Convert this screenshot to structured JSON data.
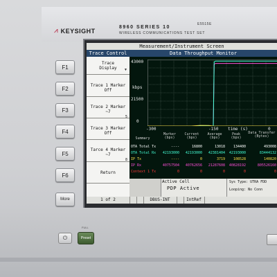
{
  "device": {
    "brand": "KEYSIGHT",
    "model": "8960 SERIES 10",
    "model_code": "E5515E",
    "subtitle": "WIRELESS COMMUNICATIONS TEST SET"
  },
  "function_keys": [
    "F1",
    "F2",
    "F3",
    "F4",
    "F5",
    "F6",
    "More"
  ],
  "screen": {
    "title": "Measurement/Instrument Screen",
    "soft_menu": {
      "header": "Trace Control",
      "items": [
        {
          "line1": "Trace",
          "line2": "Display",
          "marker": "▼"
        },
        {
          "line1": "Trace 1 Marker",
          "line2": "Off"
        },
        {
          "line1": "Trace 2 Marker",
          "line2": "~7",
          "marker": "5"
        },
        {
          "line1": "Trace 3 Marker",
          "line2": "Off"
        },
        {
          "line1": "Tarce 4 Marker",
          "line2": "~7",
          "marker": "8"
        },
        {
          "line1": "Return",
          "line2": ""
        }
      ],
      "page": "1 of 2"
    },
    "monitor": {
      "title": "Data Throughput Monitor",
      "y_unit": "kbps",
      "x_unit": "time (s)",
      "y_ticks": [
        "43000",
        "21500",
        "0"
      ],
      "x_ticks": [
        "-300",
        "-150",
        "0"
      ]
    },
    "table": {
      "headers": [
        "Summary",
        "Marker (bps)",
        "Current (bps)",
        "Average (bps)",
        "Peak (bps)",
        "Data Transfer (Bytes)"
      ],
      "rows": [
        {
          "label": "OTA Total Tx",
          "color": "#ffffff",
          "values": [
            "----",
            "16800",
            "13018",
            "134400",
            "493008"
          ]
        },
        {
          "label": "OTA Total Rx",
          "color": "#45ffd6",
          "values": [
            "42193000",
            "42193000",
            "42381404",
            "42193000",
            "83444132"
          ]
        },
        {
          "label": "IP Tx",
          "color": "#ffe24a",
          "values": [
            "----",
            "0",
            "3719",
            "108528",
            "140820"
          ]
        },
        {
          "label": "IP Rx",
          "color": "#ff4fd8",
          "values": [
            "40757504",
            "40762656",
            "21287608",
            "40828192",
            "805526160"
          ]
        },
        {
          "label": "Context 1 Tx",
          "color": "#ff3b3b",
          "values": [
            "0",
            "0",
            "0",
            "0",
            "0"
          ]
        }
      ]
    },
    "status": {
      "cell": "Active Cell",
      "cell_value": "PDP Active",
      "sys_type": "Sys Type: UTRA FDD",
      "looping": "Looping: No Conn"
    },
    "bottom_bar": [
      "DBUS-INT",
      "IntRef"
    ]
  },
  "lower_panel": {
    "full_label": "FULL",
    "preset_label": "Preset",
    "power_icon": "power-icon"
  },
  "chart_data": {
    "type": "line",
    "title": "Data Throughput Monitor",
    "xlabel": "time (s)",
    "ylabel": "kbps",
    "xlim": [
      -300,
      0
    ],
    "ylim": [
      0,
      43000
    ],
    "grid": true,
    "series": [
      {
        "name": "IP Rx",
        "color": "#ff4fd8",
        "x": [
          -300,
          -155,
          -150,
          -148,
          -145,
          0
        ],
        "y": [
          0,
          0,
          0,
          40000,
          40500,
          40500
        ]
      },
      {
        "name": "OTA Total Rx",
        "color": "#45ffd6",
        "x": [
          -300,
          -155,
          -150,
          -148,
          -145,
          0
        ],
        "y": [
          0,
          0,
          0,
          41500,
          42000,
          42000
        ]
      },
      {
        "name": "IP Tx",
        "color": "#ffe24a",
        "x": [
          -300,
          -200,
          -180,
          -160,
          -150,
          0
        ],
        "y": [
          0,
          0,
          400,
          300,
          0,
          0
        ]
      }
    ]
  }
}
